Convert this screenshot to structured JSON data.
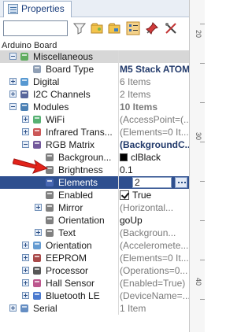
{
  "tab": {
    "label": "Properties"
  },
  "context": {
    "label": "Arduino Board"
  },
  "ruler": {
    "marks": [
      "20",
      "30",
      "40"
    ]
  },
  "tree": [
    {
      "id": "misc",
      "label": "Miscellaneous",
      "value": "",
      "kind": "cat",
      "indent": 0,
      "icon": "misc-icon"
    },
    {
      "id": "boardtype",
      "label": "Board Type",
      "value": "M5 Stack ATOM...",
      "kind": "prop",
      "indent": 1,
      "valStyle": "bold",
      "icon": "board-icon"
    },
    {
      "id": "digital",
      "label": "Digital",
      "value": "6 Items",
      "kind": "group",
      "indent": 0,
      "icon": "digital-icon"
    },
    {
      "id": "i2c",
      "label": "I2C Channels",
      "value": "2 Items",
      "kind": "group",
      "indent": 0,
      "icon": "i2c-icon"
    },
    {
      "id": "modules",
      "label": "Modules",
      "value": "10 Items",
      "kind": "group-open",
      "indent": 0,
      "valStyle": "boldgray",
      "icon": "modules-icon"
    },
    {
      "id": "wifi",
      "label": "WiFi",
      "value": "(AccessPoint=(...",
      "kind": "sub",
      "indent": 1,
      "icon": "wifi-icon"
    },
    {
      "id": "infrared",
      "label": "Infrared Trans...",
      "value": "(Elements=0 It...",
      "kind": "sub",
      "indent": 1,
      "icon": "infrared-icon"
    },
    {
      "id": "rgbmatrix",
      "label": "RGB Matrix",
      "value": "(BackgroundC...",
      "kind": "sub-open",
      "indent": 1,
      "valStyle": "bold",
      "icon": "matrix-icon"
    },
    {
      "id": "background",
      "label": "Backgroun...",
      "value": "clBlack",
      "kind": "leaf",
      "indent": 2,
      "valStyle": "dark",
      "icon": "background-icon",
      "swatch": true
    },
    {
      "id": "brightness",
      "label": "Brightness",
      "value": "0.1",
      "kind": "leaf",
      "indent": 2,
      "valStyle": "dark",
      "icon": "brightness-icon"
    },
    {
      "id": "elements",
      "label": "Elements",
      "value": "2",
      "kind": "editing",
      "indent": 2,
      "icon": "elements-icon"
    },
    {
      "id": "enabled",
      "label": "Enabled",
      "value": "True",
      "kind": "leaf",
      "indent": 2,
      "valStyle": "dark",
      "icon": "enabled-icon",
      "check": true
    },
    {
      "id": "mirror",
      "label": "Mirror",
      "value": "(Horizontal...",
      "kind": "leafexp",
      "indent": 2,
      "icon": "mirror-icon"
    },
    {
      "id": "orientation",
      "label": "Orientation",
      "value": "goUp",
      "kind": "leaf",
      "indent": 2,
      "valStyle": "dark",
      "icon": "orientation-icon"
    },
    {
      "id": "text",
      "label": "Text",
      "value": "(Backgroun...",
      "kind": "leafexp",
      "indent": 2,
      "icon": "text-icon"
    },
    {
      "id": "orient2",
      "label": "Orientation",
      "value": "(Acceleromete...",
      "kind": "sub",
      "indent": 1,
      "icon": "orientation2-icon"
    },
    {
      "id": "eeprom",
      "label": "EEPROM",
      "value": "(Elements=0 It...",
      "kind": "sub",
      "indent": 1,
      "icon": "eeprom-icon"
    },
    {
      "id": "processor",
      "label": "Processor",
      "value": "(Operations=0...",
      "kind": "sub",
      "indent": 1,
      "icon": "processor-icon"
    },
    {
      "id": "hall",
      "label": "Hall Sensor",
      "value": "(Enabled=True)",
      "kind": "sub",
      "indent": 1,
      "icon": "hall-icon"
    },
    {
      "id": "bluetooth",
      "label": "Bluetooth LE",
      "value": "(DeviceName=...",
      "kind": "sub",
      "indent": 1,
      "icon": "bluetooth-icon"
    },
    {
      "id": "serial",
      "label": "Serial",
      "value": "1 Item",
      "kind": "group",
      "indent": 0,
      "icon": "serial-icon"
    }
  ]
}
